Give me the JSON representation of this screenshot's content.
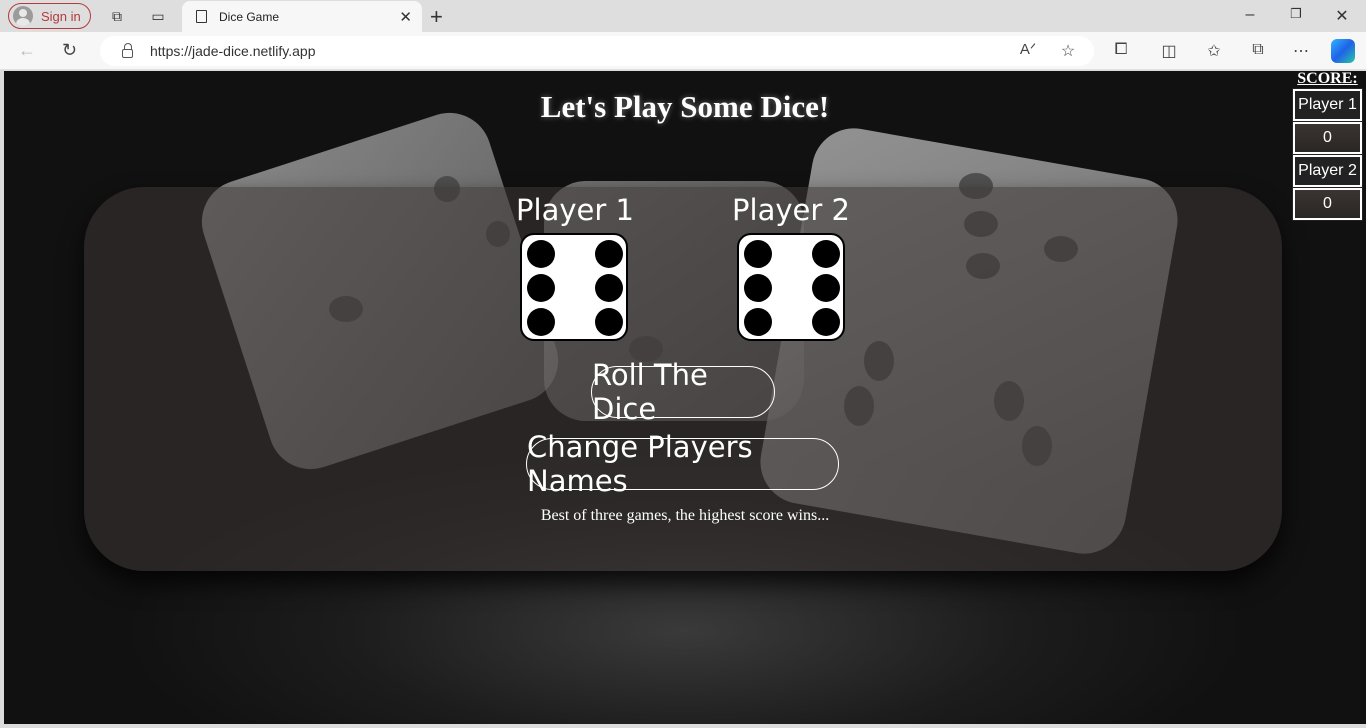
{
  "browser": {
    "sign_in": "Sign in",
    "tab_title": "Dice Game",
    "url": "https://jade-dice.netlify.app"
  },
  "page": {
    "title": "Let's Play Some Dice!",
    "players": [
      {
        "name": "Player 1",
        "die_value": 6
      },
      {
        "name": "Player 2",
        "die_value": 6
      }
    ],
    "roll_button": "Roll The Dice",
    "change_names_button": "Change Players Names",
    "note": "Best of three games, the highest score wins..."
  },
  "score": {
    "header": "SCORE:",
    "rows": [
      {
        "name": "Player 1",
        "value": "0"
      },
      {
        "name": "Player 2",
        "value": "0"
      }
    ]
  },
  "colors": {
    "accent": "#b23b3b",
    "page_bg": "#111111",
    "panel": "#3c3735"
  }
}
